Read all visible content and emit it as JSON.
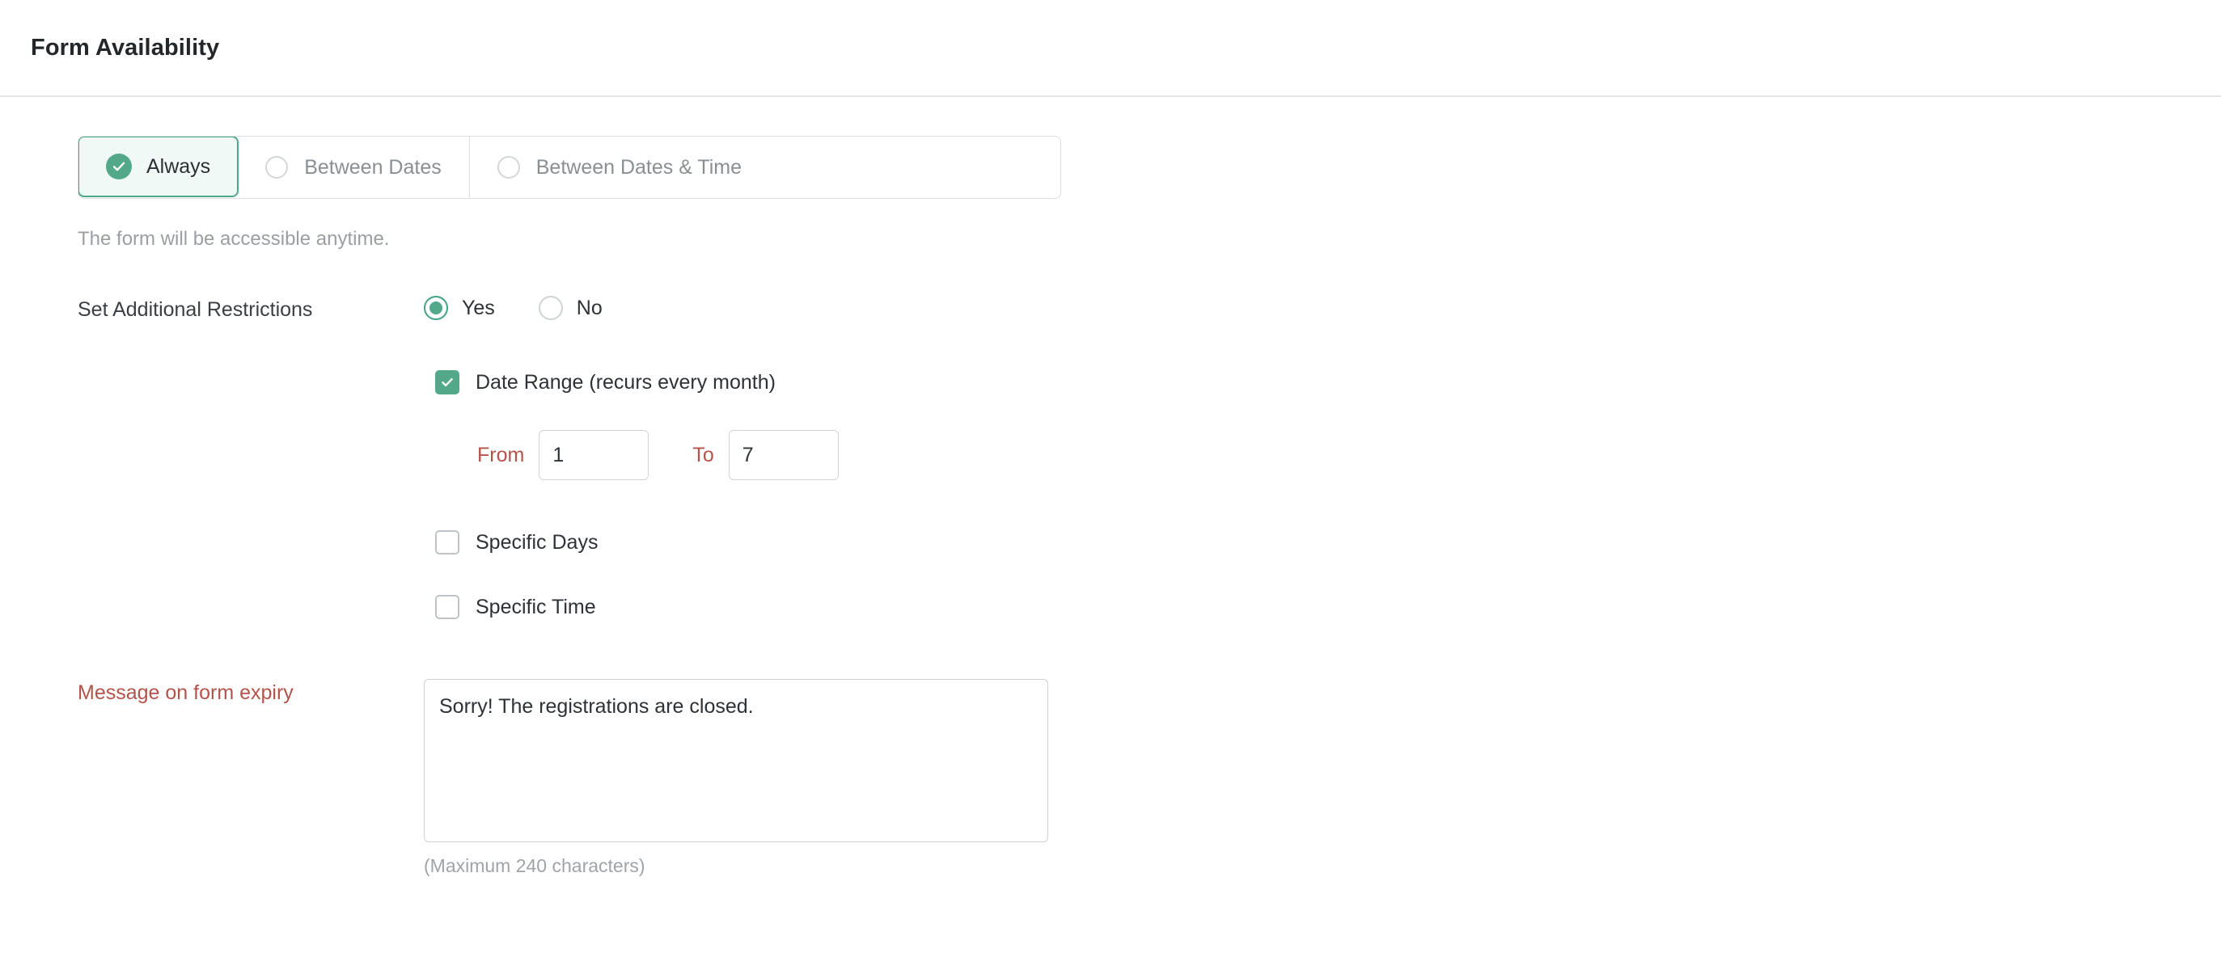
{
  "header": {
    "title": "Form Availability"
  },
  "availability": {
    "tabs": [
      {
        "label": "Always",
        "selected": true,
        "icon": "check-circle-icon"
      },
      {
        "label": "Between Dates",
        "selected": false,
        "icon": "radio-icon"
      },
      {
        "label": "Between Dates & Time",
        "selected": false,
        "icon": "radio-icon"
      }
    ],
    "hint": "The form will be accessible anytime."
  },
  "restrictions": {
    "label": "Set Additional Restrictions",
    "options": [
      {
        "label": "Yes",
        "selected": true
      },
      {
        "label": "No",
        "selected": false
      }
    ],
    "date_range": {
      "label": "Date Range (recurs every month)",
      "checked": true,
      "from_label": "From",
      "from_value": "1",
      "to_label": "To",
      "to_value": "7"
    },
    "specific_days": {
      "label": "Specific Days",
      "checked": false
    },
    "specific_time": {
      "label": "Specific Time",
      "checked": false
    }
  },
  "expiry": {
    "label": "Message on form expiry",
    "value": "Sorry! The registrations are closed.",
    "hint": "(Maximum 240 characters)"
  },
  "colors": {
    "accent_green": "#52a98a",
    "accent_green_bg": "#f0f9f5",
    "required_red": "#b4534a",
    "border_grey": "#dcdfe2",
    "muted_text": "#9b9fa3"
  }
}
